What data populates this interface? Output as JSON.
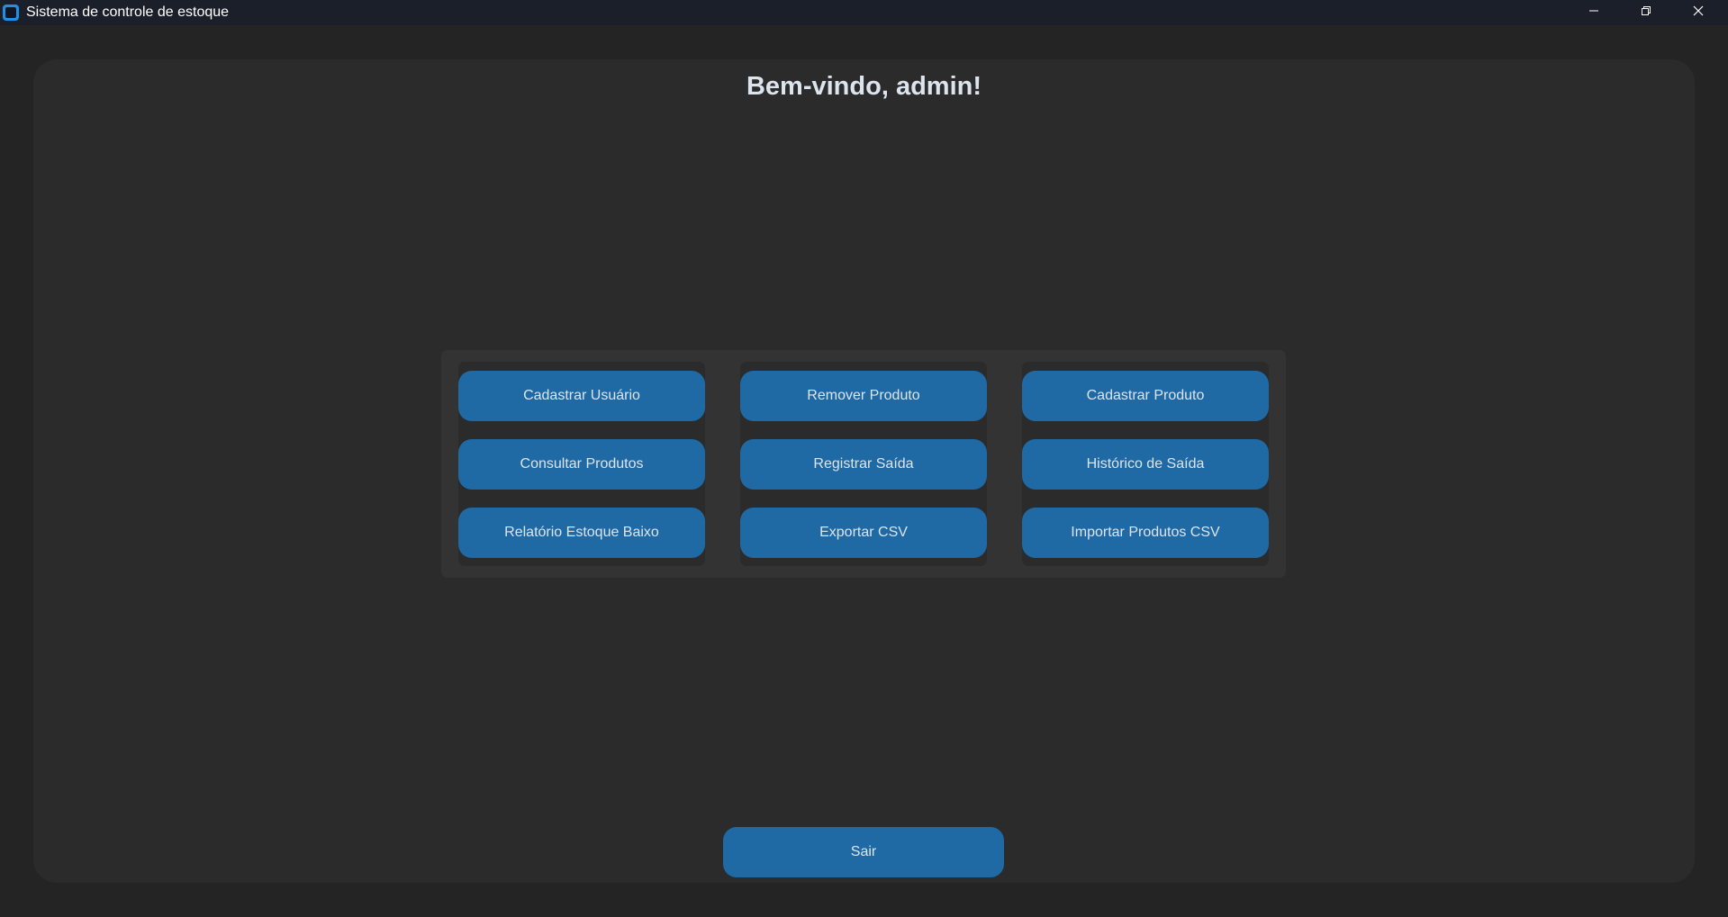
{
  "window": {
    "title": "Sistema de controle de estoque",
    "icon": "app-icon",
    "controls": [
      "minimize-icon",
      "restore-icon",
      "close-icon"
    ]
  },
  "header": {
    "welcome": "Bem-vindo, admin!"
  },
  "menu": {
    "columns": [
      {
        "buttons": [
          "Cadastrar Usuário",
          "Consultar Produtos",
          "Relatório Estoque Baixo"
        ]
      },
      {
        "buttons": [
          "Remover Produto",
          "Registrar Saída",
          "Exportar CSV"
        ]
      },
      {
        "buttons": [
          "Cadastrar Produto",
          "Histórico de Saída",
          "Importar Produtos CSV"
        ]
      }
    ]
  },
  "footer": {
    "exit_label": "Sair"
  },
  "colors": {
    "background": "#242424",
    "panel": "#2b2b2b",
    "grid_frame": "#333333",
    "button": "#1f6aa5",
    "button_text": "#dce4ee",
    "titlebar": "#1b1f29"
  }
}
